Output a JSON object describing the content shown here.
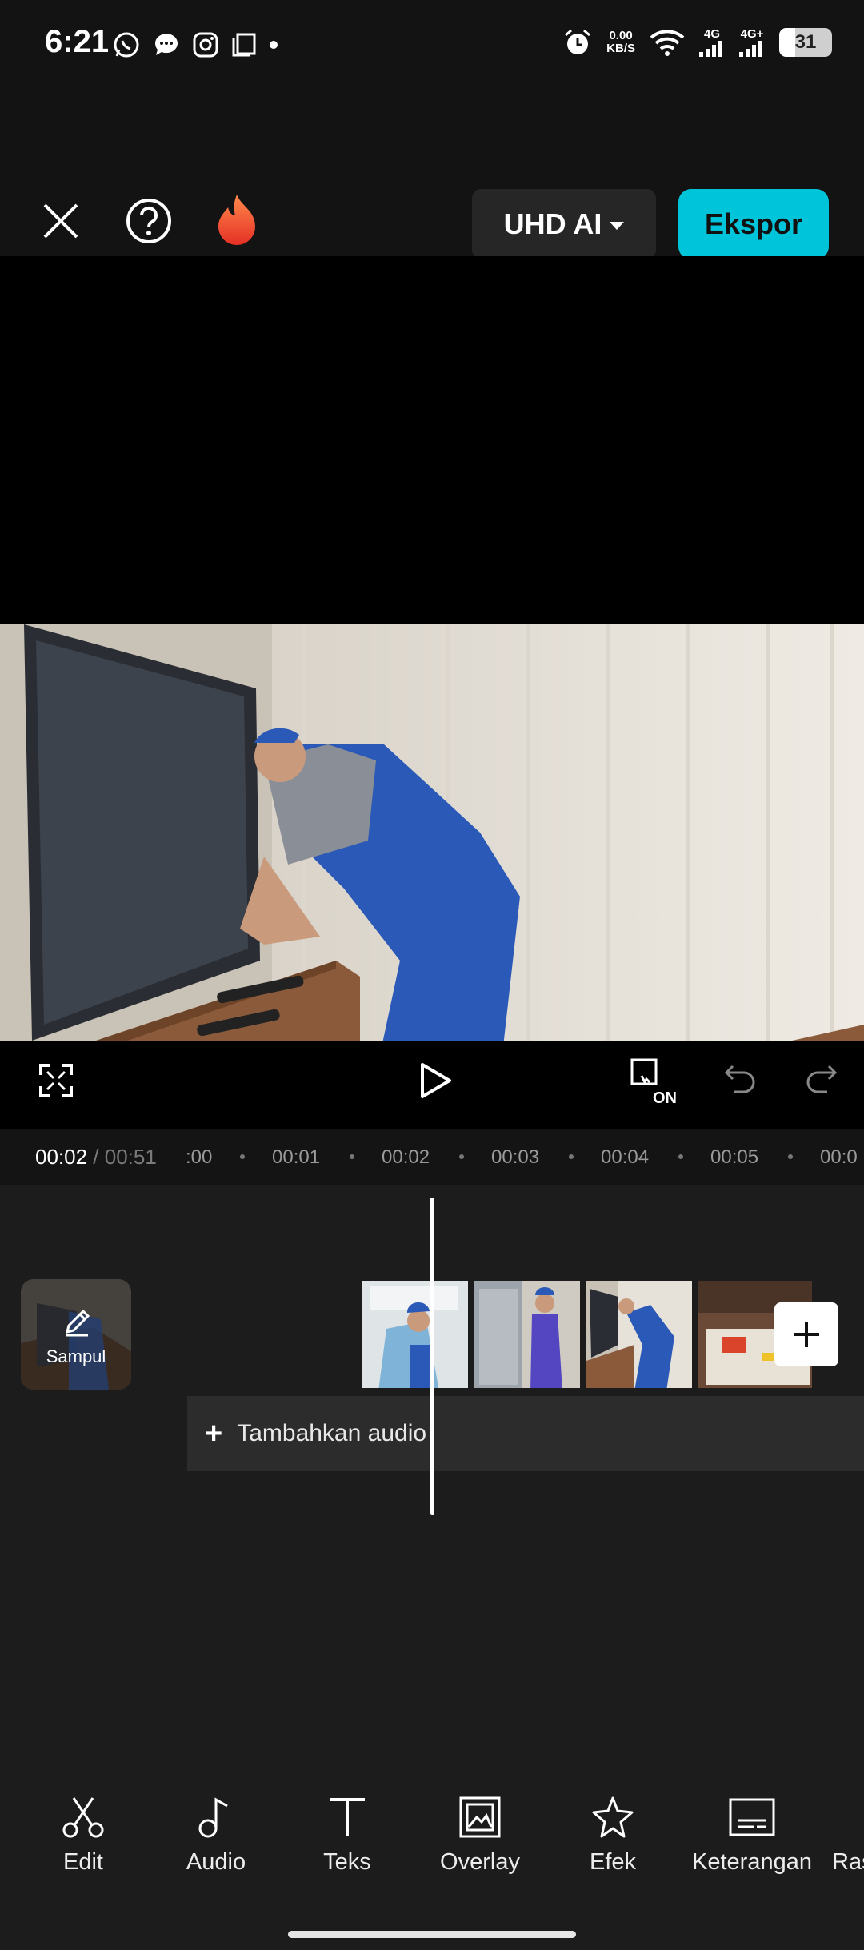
{
  "status_bar": {
    "time": "6:21",
    "net_speed_value": "0.00",
    "net_speed_unit": "KB/S",
    "signal_1": "4G",
    "signal_2": "4G+",
    "battery": "31",
    "battery_level": 0.31,
    "left_icons": [
      "whatsapp-icon",
      "message-icon",
      "instagram-icon",
      "copy-icon",
      "dot-icon"
    ],
    "right_icons": [
      "alarm-icon",
      "wifi-icon",
      "signal-icon",
      "signal-icon",
      "battery-icon"
    ]
  },
  "toolbar": {
    "close_icon": "close-icon",
    "help_icon": "help-icon",
    "flame_icon": "flame-icon",
    "quality_label": "UHD AI",
    "export_label": "Ekspor",
    "accent_color": "#00c4d9"
  },
  "preview": {
    "description": "video frame of technician fixing TV"
  },
  "controls": {
    "fullscreen_icon": "fullscreen-icon",
    "play_icon": "play-icon",
    "keyframe_badge": "ON",
    "undo_icon": "undo-icon",
    "redo_icon": "redo-icon"
  },
  "timeline": {
    "current_time": "00:02",
    "total_time": " / 00:51",
    "ticks": [
      ":00",
      "00:01",
      "00:02",
      "00:03",
      "00:04",
      "00:05",
      "00:0"
    ],
    "cover_label": "Sampul",
    "add_audio_label": "Tambahkan audio",
    "clips": [
      "clip-ac-repair",
      "clip-fridge-worker",
      "clip-tv-repair",
      "clip-workbench"
    ]
  },
  "bottom_tools": [
    {
      "label": "Edit",
      "icon": "scissors-icon"
    },
    {
      "label": "Audio",
      "icon": "music-note-icon"
    },
    {
      "label": "Teks",
      "icon": "text-icon"
    },
    {
      "label": "Overlay",
      "icon": "overlay-icon"
    },
    {
      "label": "Efek",
      "icon": "star-icon"
    },
    {
      "label": "Keterangan",
      "icon": "captions-icon"
    },
    {
      "label": "Ras",
      "icon": "ratio-icon"
    }
  ]
}
